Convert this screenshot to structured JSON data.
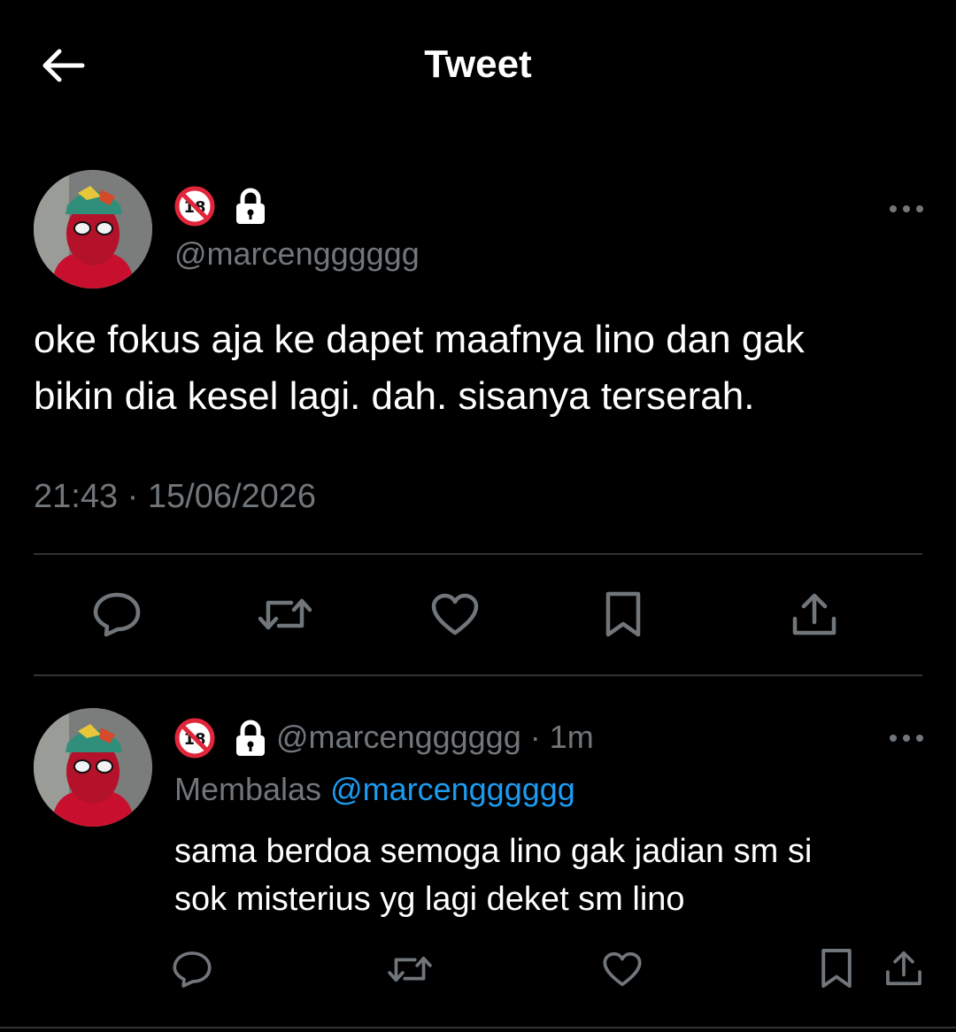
{
  "header": {
    "title": "Tweet"
  },
  "tweet": {
    "handle": "@marcengggggg",
    "text_line1": "oke fokus aja ke dapet maafnya lino dan gak",
    "text_line2": "bikin dia kesel lagi. dah. sisanya terserah.",
    "timestamp": "21:43 · 15/06/2026"
  },
  "reply": {
    "handle": "@marcengggggg",
    "separator": " · ",
    "time": "1m",
    "replying_label": "Membalas ",
    "replying_to": "@marcengggggg",
    "text_line1": "sama berdoa semoga lino gak jadian sm si",
    "text_line2": "sok misterius yg lagi deket sm lino"
  },
  "icons": {
    "back": "arrow-left-icon",
    "badge": "no-under-18-icon",
    "lock": "lock-icon",
    "more": "more-dots-icon",
    "reply": "comment-icon",
    "retweet": "retweet-icon",
    "like": "heart-icon",
    "bookmark": "bookmark-icon",
    "share": "share-icon"
  },
  "colors": {
    "background": "#000000",
    "text": "#e7e9ea",
    "muted": "#71767b",
    "link": "#1d9bf0",
    "divider": "#2f3336"
  }
}
